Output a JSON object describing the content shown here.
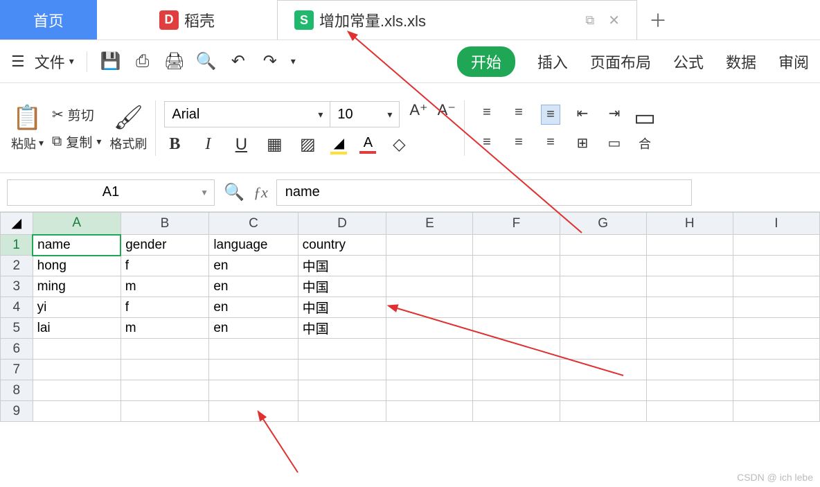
{
  "tabs": {
    "home": "首页",
    "docshell": "稻壳",
    "active_file": "增加常量.xls.xls"
  },
  "toolbar": {
    "file_label": "文件",
    "ribbon": {
      "start": "开始",
      "insert": "插入",
      "layout": "页面布局",
      "formula": "公式",
      "data": "数据",
      "review": "审阅"
    }
  },
  "format": {
    "paste": "粘贴",
    "cut": "剪切",
    "copy": "复制",
    "format_painter": "格式刷",
    "font_name": "Arial",
    "font_size": "10",
    "merge": "合"
  },
  "name_box": "A1",
  "formula_value": "name",
  "columns": [
    "A",
    "B",
    "C",
    "D",
    "E",
    "F",
    "G",
    "H",
    "I"
  ],
  "row_count": 9,
  "sheet": {
    "headers": [
      "name",
      "gender",
      "language",
      "country"
    ],
    "rows": [
      [
        "hong",
        "f",
        "en",
        "中国"
      ],
      [
        "ming",
        "m",
        "en",
        "中国"
      ],
      [
        "yi",
        "f",
        "en",
        "中国"
      ],
      [
        "lai",
        "m",
        "en",
        "中国"
      ]
    ]
  },
  "selected_cell": {
    "row": 1,
    "col": "A"
  },
  "watermark": "CSDN @ ich lebe"
}
